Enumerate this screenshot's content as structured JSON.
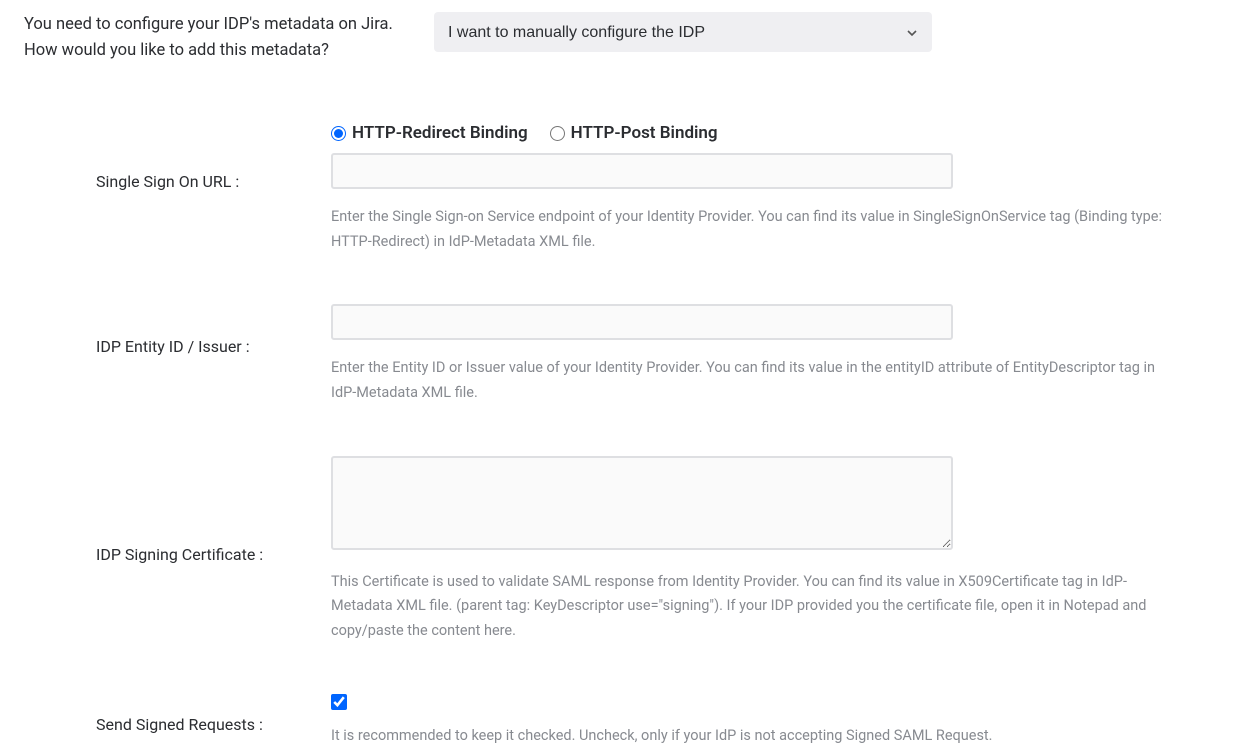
{
  "prompt": "You need to configure your IDP's metadata on Jira. How would you like to add this metadata?",
  "select": {
    "value": "I want to manually configure the IDP"
  },
  "fields": {
    "sso": {
      "label": "Single Sign On URL :",
      "radios": {
        "redirect": "HTTP-Redirect Binding",
        "post": "HTTP-Post Binding"
      },
      "value": "",
      "hint": "Enter the Single Sign-on Service endpoint of your Identity Provider. You can find its value in SingleSignOnService tag (Binding type: HTTP-Redirect) in IdP-Metadata XML file."
    },
    "entity": {
      "label": "IDP Entity ID / Issuer :",
      "value": "",
      "hint": "Enter the Entity ID or Issuer value of your Identity Provider. You can find its value in the entityID attribute of EntityDescriptor tag in IdP-Metadata XML file."
    },
    "cert": {
      "label": "IDP Signing Certificate :",
      "value": "",
      "hint": "This Certificate is used to validate SAML response from Identity Provider. You can find its value in X509Certificate tag in IdP-Metadata XML file. (parent tag: KeyDescriptor use=\"signing\"). If your IDP provided you the certificate file, open it in Notepad and copy/paste the content here."
    },
    "signed": {
      "label": "Send Signed Requests :",
      "checked": true,
      "hint": "It is recommended to keep it checked. Uncheck, only if your IdP is not accepting Signed SAML Request."
    }
  }
}
